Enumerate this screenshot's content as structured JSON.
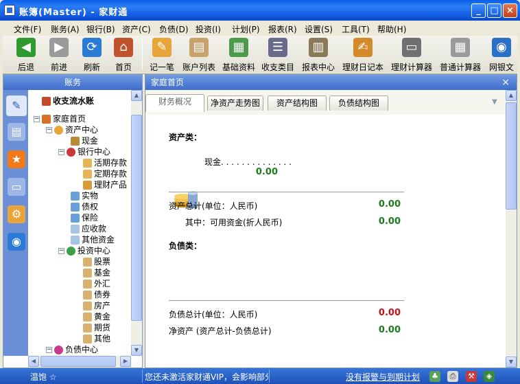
{
  "window": {
    "title": "账簿(Master) - 家财通"
  },
  "menu": [
    "文件(F)",
    "账务(A)",
    "银行(B)",
    "资产(C)",
    "负债(D)",
    "投资(I)",
    "计划(P)",
    "报表(R)",
    "设置(S)",
    "工具(T)",
    "帮助(H)"
  ],
  "toolbar": {
    "back": "后退",
    "forward": "前进",
    "refresh": "刷新",
    "home": "首页",
    "record": "记一笔",
    "account_list": "账户列表",
    "base_data": "基础资料",
    "category": "收支类目",
    "report_center": "报表中心",
    "diary": "理财日记本",
    "finance_calc": "理财计算器",
    "normal_calc": "普通计算器",
    "online_bank": "网银文"
  },
  "left_panel": {
    "header": "账务",
    "flow_title": "收支流水账",
    "tree": {
      "root": "家庭首页",
      "asset_center": "资产中心",
      "cash": "现金",
      "bank_center": "银行中心",
      "demand_deposit": "活期存款",
      "fixed_deposit": "定期存款",
      "wealth_product": "理财产品",
      "physical": "实物",
      "claims": "债权",
      "insurance": "保险",
      "receivable": "应收款",
      "other_funds": "其他资金",
      "invest_center": "投资中心",
      "stock": "股票",
      "fund": "基金",
      "forex": "外汇",
      "bond": "债券",
      "property": "房产",
      "gold": "黄金",
      "futures": "期货",
      "other": "其他",
      "debt_center": "负债中心"
    }
  },
  "main": {
    "header": "家庭首页",
    "close": "×",
    "tabs": [
      "财务概况",
      "净资产走势图",
      "资产结构图",
      "负债结构图"
    ],
    "assets_title": "资产类：",
    "cash_label": "现金. . . . . . . . . . . . . .",
    "cash_value": "0.00",
    "asset_total_label": "资产总计(单位：人民币)",
    "asset_total_value": "0.00",
    "available_label": "其中：可用资金(折人民币)",
    "available_value": "0.00",
    "liabilities_title": "负债类：",
    "liability_total_label": "负债总计(单位：人民币)",
    "liability_total_value": "0.00",
    "net_asset_label": "净资产 (资产总计-负债总计)",
    "net_asset_value": "0.00"
  },
  "status": {
    "user": "温饱 ☆",
    "message": "您还未激活家财通VIP，会影响部分",
    "link": "没有报警与到期计划"
  },
  "colors": {
    "positive": "#1e7a1e",
    "negative": "#c01515",
    "header_blue": "#3d6cc9"
  }
}
